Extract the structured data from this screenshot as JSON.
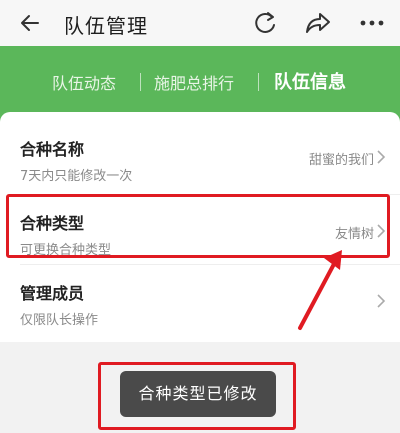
{
  "header": {
    "title": "队伍管理",
    "back_icon": "arrow-left-icon",
    "actions": [
      "refresh-icon",
      "share-icon",
      "more-icon"
    ]
  },
  "tabs": [
    {
      "label": "队伍动态",
      "active": false
    },
    {
      "label": "施肥总排行",
      "active": false
    },
    {
      "label": "队伍信息",
      "active": true
    }
  ],
  "rows": [
    {
      "title": "合种名称",
      "subtitle": "7天内只能修改一次",
      "value": "甜蜜的我们"
    },
    {
      "title": "合种类型",
      "subtitle": "可更换合种类型",
      "value": "友情树"
    },
    {
      "title": "管理成员",
      "subtitle": "仅限队长操作",
      "value": ""
    }
  ],
  "toast": {
    "text": "合种类型已修改"
  },
  "colors": {
    "green": "#5bb75a",
    "annotation_red": "#e01b22",
    "toast_bg": "#4a4a4a"
  }
}
